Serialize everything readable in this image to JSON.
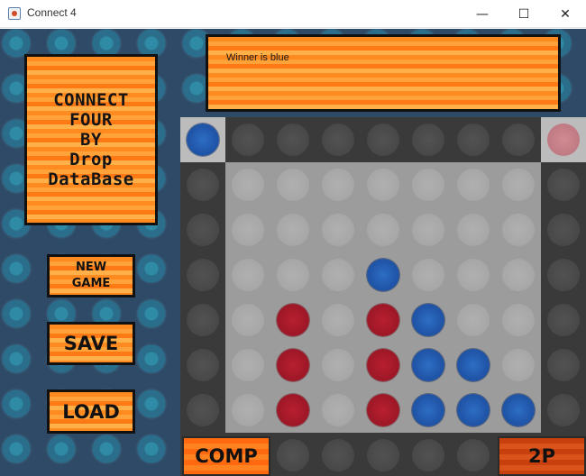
{
  "window": {
    "title": "Connect 4",
    "controls": {
      "minimize": "—",
      "maximize": "☐",
      "close": "✕"
    }
  },
  "logo": {
    "text": "CONNECT\nFOUR\nBY\nDrop\nDataBase"
  },
  "buttons": {
    "new_game": "NEW\nGAME",
    "save": "SAVE",
    "load": "LOAD",
    "comp": "COMP",
    "two_player": "2P"
  },
  "message": {
    "text": "Winner is blue"
  },
  "board": {
    "columns": 7,
    "rows": 6,
    "grid": [
      [
        "",
        "",
        "",
        "",
        "",
        "",
        ""
      ],
      [
        "",
        "",
        "",
        "",
        "",
        "",
        ""
      ],
      [
        "",
        "",
        "",
        "blue",
        "",
        "",
        ""
      ],
      [
        "",
        "red",
        "",
        "red",
        "blue",
        "",
        ""
      ],
      [
        "",
        "red",
        "",
        "red",
        "blue",
        "blue",
        ""
      ],
      [
        "",
        "red",
        "",
        "red",
        "blue",
        "blue",
        "blue"
      ]
    ],
    "hover_token_left": "blue",
    "hover_token_right": "ghost-red"
  },
  "colors": {
    "background": "#2e4a66",
    "accent_orange": "#ff8a1f",
    "red_token": "#a01828",
    "blue_token": "#2157aa",
    "board_frame": "#3a3a3a",
    "board_inner": "#9c9c9c"
  }
}
